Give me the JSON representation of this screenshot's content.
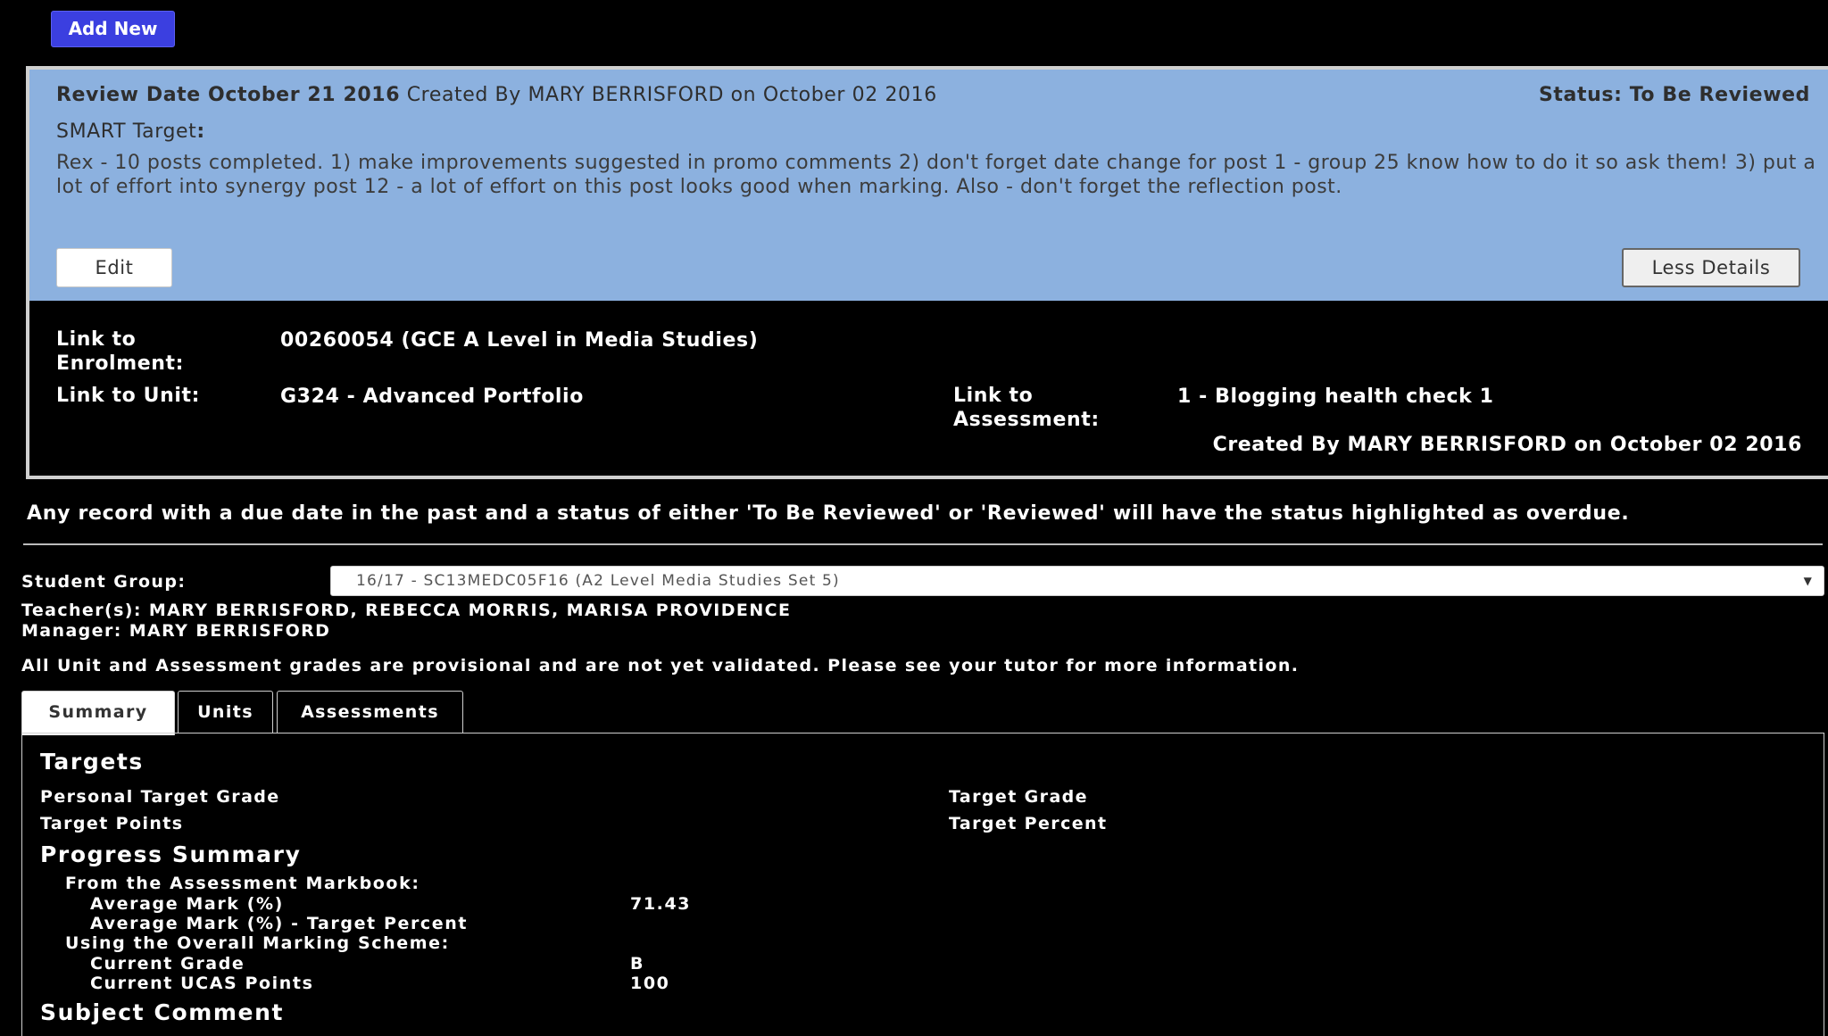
{
  "toolbar": {
    "add_new_label": "Add New"
  },
  "review": {
    "review_date_label": "Review Date October 21 2016",
    "created_by_text": "Created By MARY BERRISFORD on October 02 2016",
    "status_text": "Status: To Be Reviewed",
    "smart_target_label": "SMART Target",
    "smart_target_colon": ":",
    "smart_target_text": "Rex - 10 posts completed. 1) make improvements suggested in promo comments 2) don't forget date change for post 1 - group 25 know how to do it so ask them! 3) put a lot of effort into synergy post 12 - a lot of effort on this post looks good when marking. Also - don't forget the reflection post.",
    "edit_label": "Edit",
    "less_details_label": "Less Details",
    "details": {
      "enrolment_label": "Link to Enrolment:",
      "enrolment_value": "00260054 (GCE A Level in Media Studies)",
      "unit_label": "Link to Unit:",
      "unit_value": "G324 - Advanced Portfolio",
      "assessment_label": "Link to Assessment:",
      "assessment_value": "1 - Blogging health check 1",
      "created_by": "Created By MARY BERRISFORD on October 02 2016"
    }
  },
  "overdue_note": "Any record with a due date in the past and a status of either 'To Be Reviewed' or 'Reviewed' will have the status highlighted as overdue.",
  "student_group": {
    "label": "Student Group:",
    "selected": "16/17 - SC13MEDC05F16 (A2 Level Media Studies Set 5)",
    "teachers": "Teacher(s): MARY BERRISFORD, REBECCA MORRIS, MARISA PROVIDENCE",
    "manager": "Manager: MARY BERRISFORD",
    "grades_note": "All Unit and Assessment grades are provisional and are not yet validated. Please see your tutor for more information."
  },
  "tabs": [
    {
      "label": "Summary",
      "active": true
    },
    {
      "label": "Units",
      "active": false
    },
    {
      "label": "Assessments",
      "active": false
    }
  ],
  "summary": {
    "targets_heading": "Targets",
    "personal_target_grade": "Personal Target Grade",
    "target_grade": "Target Grade",
    "target_points": "Target Points",
    "target_percent": "Target Percent",
    "progress_heading": "Progress Summary",
    "markbook_heading": "From the Assessment Markbook:",
    "avg_mark_label": "Average Mark (%)",
    "avg_mark_value": "71.43",
    "avg_mark_target_label": "Average Mark (%) - Target Percent",
    "scheme_heading": "Using the Overall Marking Scheme:",
    "current_grade_label": "Current Grade",
    "current_grade_value": "B",
    "ucas_label": "Current UCAS Points",
    "ucas_value": "100",
    "subject_comment_heading": "Subject Comment"
  },
  "colors": {
    "add_button": "#3b3fe0",
    "review_header": "#8cb1df",
    "background": "#000000"
  }
}
